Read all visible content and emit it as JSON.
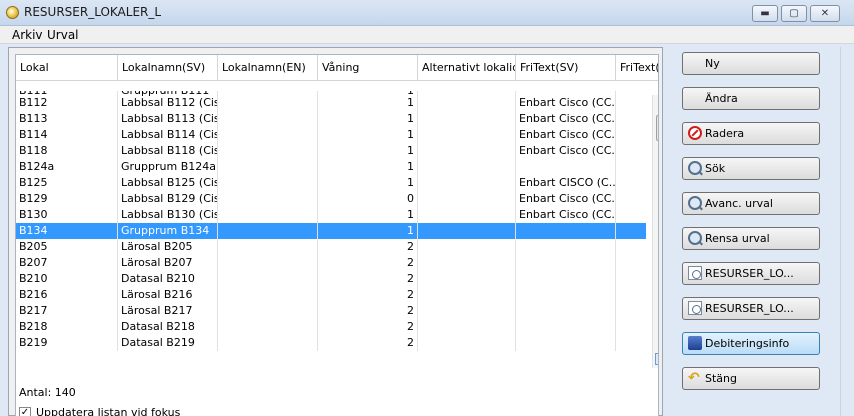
{
  "window": {
    "title": "RESURSER_LOKALER_L",
    "minimize": "▬",
    "maximize": "▢",
    "close": "✕"
  },
  "menu": [
    "Arkiv",
    "Urval"
  ],
  "table": {
    "columns": [
      "Lokal",
      "Lokalnamn(SV)",
      "Lokalnamn(EN)",
      "Våning",
      "Alternativt lokalid",
      "FriText(SV)",
      "FriText(E"
    ],
    "partial_top": {
      "lokal": "B111",
      "sv": "Grupprum B111",
      "floor": "1"
    },
    "rows": [
      {
        "lokal": "B112",
        "sv": "Labbsal B112 (Cis...",
        "en": "",
        "floor": "1",
        "alt": "",
        "fri": "Enbart Cisco (CC..."
      },
      {
        "lokal": "B113",
        "sv": "Labbsal B113 (Cis...",
        "en": "",
        "floor": "1",
        "alt": "",
        "fri": "Enbart Cisco (CC..."
      },
      {
        "lokal": "B114",
        "sv": "Labbsal B114 (Cis...",
        "en": "",
        "floor": "1",
        "alt": "",
        "fri": "Enbart Cisco (CC..."
      },
      {
        "lokal": "B118",
        "sv": "Labbsal B118 (Cis...",
        "en": "",
        "floor": "1",
        "alt": "",
        "fri": "Enbart Cisco (CC..."
      },
      {
        "lokal": "B124a",
        "sv": "Grupprum B124a",
        "en": "",
        "floor": "1",
        "alt": "",
        "fri": ""
      },
      {
        "lokal": "B125",
        "sv": "Labbsal B125 (Cis...",
        "en": "",
        "floor": "1",
        "alt": "",
        "fri": "Enbart CISCO (C..."
      },
      {
        "lokal": "B129",
        "sv": "Labbsal B129 (Cis...",
        "en": "",
        "floor": "0",
        "alt": "",
        "fri": "Enbart Cisco (CC..."
      },
      {
        "lokal": "B130",
        "sv": "Labbsal B130 (Cis...",
        "en": "",
        "floor": "1",
        "alt": "",
        "fri": "Enbart Cisco (CC..."
      },
      {
        "lokal": "B134",
        "sv": "Grupprum B134",
        "en": "",
        "floor": "1",
        "alt": "",
        "fri": "",
        "selected": true
      },
      {
        "lokal": "B205",
        "sv": "Lärosal B205",
        "en": "",
        "floor": "2",
        "alt": "",
        "fri": ""
      },
      {
        "lokal": "B207",
        "sv": "Lärosal B207",
        "en": "",
        "floor": "2",
        "alt": "",
        "fri": ""
      },
      {
        "lokal": "B210",
        "sv": "Datasal B210",
        "en": "",
        "floor": "2",
        "alt": "",
        "fri": ""
      },
      {
        "lokal": "B216",
        "sv": "Lärosal B216",
        "en": "",
        "floor": "2",
        "alt": "",
        "fri": ""
      },
      {
        "lokal": "B217",
        "sv": "Lärosal B217",
        "en": "",
        "floor": "2",
        "alt": "",
        "fri": ""
      },
      {
        "lokal": "B218",
        "sv": "Datasal B218",
        "en": "",
        "floor": "2",
        "alt": "",
        "fri": ""
      },
      {
        "lokal": "B219",
        "sv": "Datasal B219",
        "en": "",
        "floor": "2",
        "alt": "",
        "fri": ""
      }
    ],
    "hscroll_grip": "|||"
  },
  "footer": {
    "count": "Antal: 140",
    "update_check": "✓",
    "update_label": "Uppdatera listan vid fokus"
  },
  "buttons": [
    {
      "name": "new-button",
      "label": "Ny",
      "icon": "none"
    },
    {
      "name": "edit-button",
      "label": "Ändra",
      "icon": "none"
    },
    {
      "name": "delete-button",
      "label": "Radera",
      "icon": "delete-icon"
    },
    {
      "name": "search-button",
      "label": "Sök",
      "icon": "search-icon"
    },
    {
      "name": "advanced-filter-button",
      "label": "Avanc. urval",
      "icon": "search-icon"
    },
    {
      "name": "clear-filter-button",
      "label": "Rensa urval",
      "icon": "search-icon"
    },
    {
      "name": "report-button-1",
      "label": "RESURSER_LO...",
      "icon": "report-icon"
    },
    {
      "name": "report-button-2",
      "label": "RESURSER_LO...",
      "icon": "report-icon"
    },
    {
      "name": "billing-info-button",
      "label": "Debiteringsinfo",
      "icon": "billing-icon",
      "active": true
    },
    {
      "name": "close-window-button",
      "label": "Stäng",
      "icon": "back-arrow-icon"
    }
  ]
}
